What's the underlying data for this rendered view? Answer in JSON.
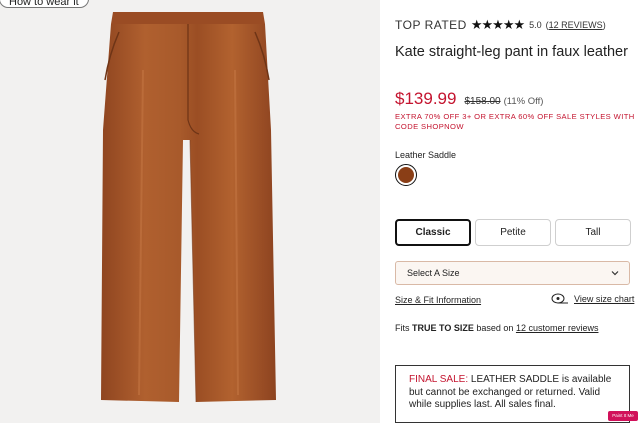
{
  "image_panel": {
    "how_to_label": "How to wear it",
    "pant_color": "#a2542a"
  },
  "product": {
    "top_rated_label": "TOP RATED",
    "stars": "★★★★★",
    "rating": "5.0",
    "reviews_open": "(",
    "reviews_link": "12 REVIEWS",
    "reviews_close": ")",
    "title": "Kate straight-leg pant in faux leather",
    "sale_price": "$139.99",
    "original_price": "$158.00",
    "discount": "(11% Off)",
    "promo": "EXTRA 70% OFF 3+ OR EXTRA 60% OFF SALE STYLES WITH CODE SHOPNOW",
    "color_name": "Leather Saddle",
    "swatch_color": "#8a3e16",
    "accent_red": "#c4142f"
  },
  "fit_options": [
    {
      "label": "Classic",
      "selected": true
    },
    {
      "label": "Petite",
      "selected": false
    },
    {
      "label": "Tall",
      "selected": false
    }
  ],
  "size_select": {
    "selected": "Select A Size"
  },
  "links": {
    "size_fit": "Size & Fit Information",
    "view_chart": "View size chart"
  },
  "fits": {
    "prefix": "Fits",
    "bold": "TRUE TO SIZE",
    "middle": "based on",
    "link": "12 customer reviews"
  },
  "final_sale": {
    "label": "FINAL SALE:",
    "text": "LEATHER SADDLE is available but cannot be exchanged or returned. Valid while supplies last. All sales final."
  },
  "badge_text": "Paint It Me"
}
